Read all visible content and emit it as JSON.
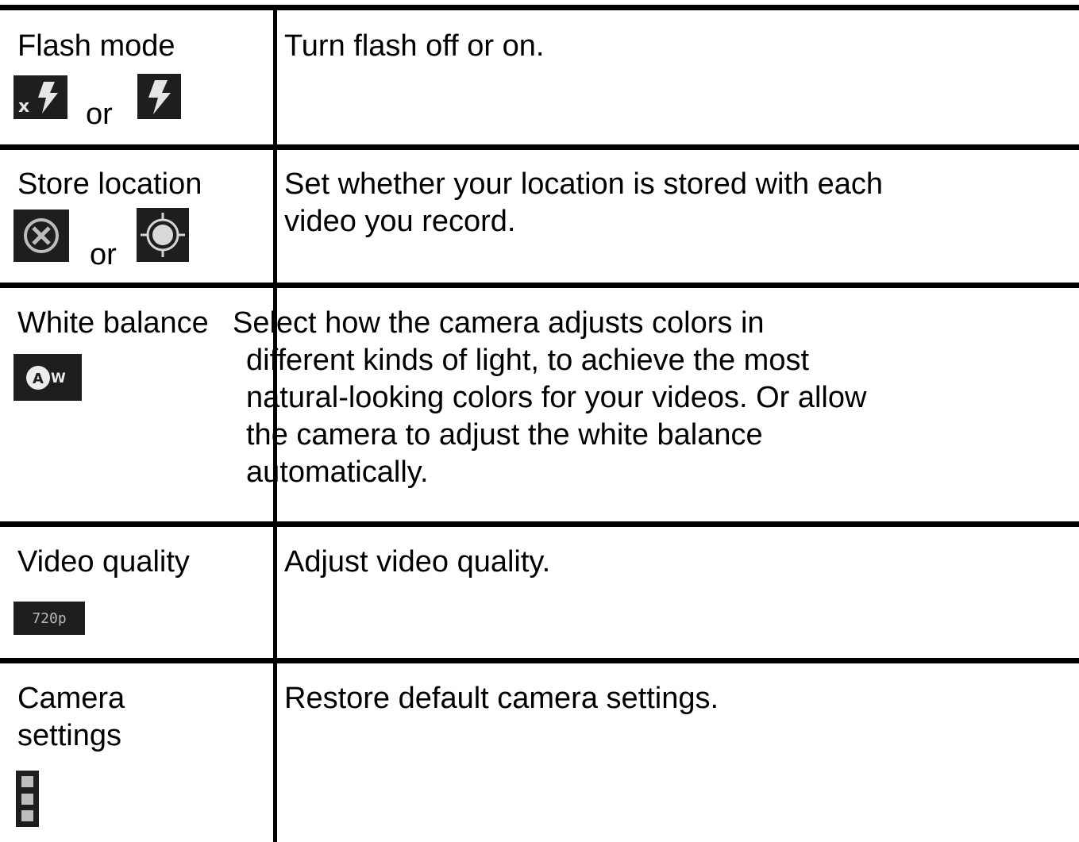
{
  "rows": [
    {
      "name": "Flash mode",
      "icons": [
        "flash-off-icon",
        "flash-on-icon"
      ],
      "or_text": "or",
      "description": "Turn flash off or on."
    },
    {
      "name": "Store location",
      "icons": [
        "location-off-icon",
        "location-on-icon"
      ],
      "or_text": "or",
      "description": "Set whether your location is stored with each video you record."
    },
    {
      "name": "White balance",
      "icons": [
        "auto-white-balance-icon"
      ],
      "icon_text": "AW",
      "description_lines": [
        "Select how the camera adjusts colors in",
        "different kinds of light, to achieve the most",
        "natural-looking colors for your videos. Or allow",
        "the camera to adjust the white balance",
        "automatically."
      ]
    },
    {
      "name": "Video quality",
      "icons": [
        "video-quality-icon"
      ],
      "icon_text": "720p",
      "description": "Adjust video quality."
    },
    {
      "name": "Camera settings",
      "icons": [
        "camera-settings-menu-icon"
      ],
      "description": "Restore default camera settings."
    }
  ],
  "colors": {
    "rule": "#000000",
    "icon_bg": "#1e1e1e",
    "icon_fg": "#e0e0e0"
  }
}
